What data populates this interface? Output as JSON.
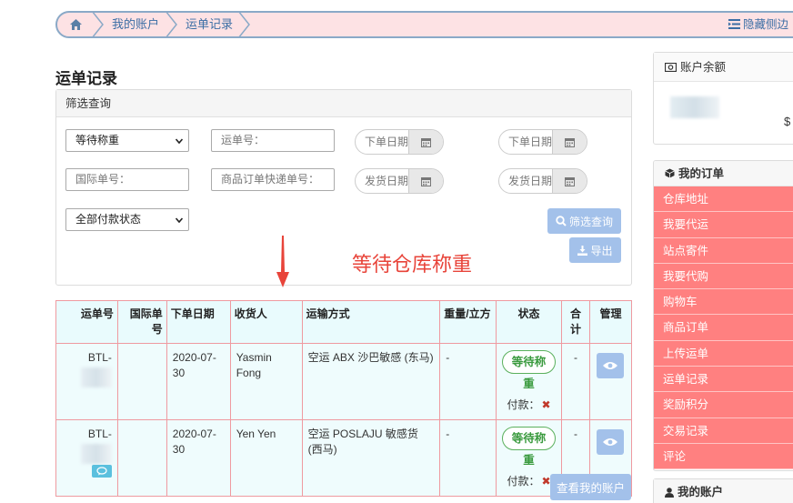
{
  "breadcrumb": {
    "items": [
      "我的账户",
      "运单记录"
    ],
    "hide_sidebar": "隐藏侧边"
  },
  "page_title": "运单记录",
  "filter": {
    "title": "筛选查询",
    "status_select": "等待称重",
    "waybill_placeholder": "运单号：",
    "order_date_from": "下单日期",
    "order_date_to": "下单日期",
    "intl_placeholder": "国际单号：",
    "express_placeholder": "商品订单快递单号：",
    "ship_date_from": "发货日期",
    "ship_date_to": "发货日期",
    "pay_select": "全部付款状态",
    "search_button": "筛选查询",
    "export_button": "导出"
  },
  "annotation": "等待仓库称重",
  "table": {
    "headers": [
      "运单号",
      "国际单号",
      "下单日期",
      "收货人",
      "运输方式",
      "重量/立方",
      "状态",
      "合计",
      "管理"
    ],
    "rows": [
      {
        "waybill": "BTL-",
        "intl_no": "",
        "date": "2020-07-30",
        "receiver": "Yasmin Fong",
        "shipping": "空运 ABX 沙巴敏感 (东马)",
        "weight": "-",
        "status": "等待称重",
        "pay_label": "付款：",
        "total": "-"
      },
      {
        "waybill": "BTL-",
        "intl_no": "",
        "date": "2020-07-30",
        "receiver": "Yen Yen",
        "shipping": "空运 POSLAJU 敏感货 (西马)",
        "weight": "-",
        "status": "等待称重",
        "pay_label": "付款：",
        "total": "-"
      }
    ]
  },
  "view_account_button": "查看我的账户",
  "sidebar": {
    "balance_title": "账户余额",
    "balance_currency": "$",
    "orders_title": "我的订单",
    "menu": [
      "仓库地址",
      "我要代运",
      "站点寄件",
      "我要代购",
      "购物车",
      "商品订单",
      "上传运单",
      "运单记录",
      "奖励积分",
      "交易记录",
      "评论"
    ],
    "account_title": "我的账户"
  },
  "colors": {
    "accent_blue": "#a3c1ea",
    "menu_red": "#ff8080",
    "status_green": "#3a9a3e",
    "annotation_red": "#e8443a"
  }
}
